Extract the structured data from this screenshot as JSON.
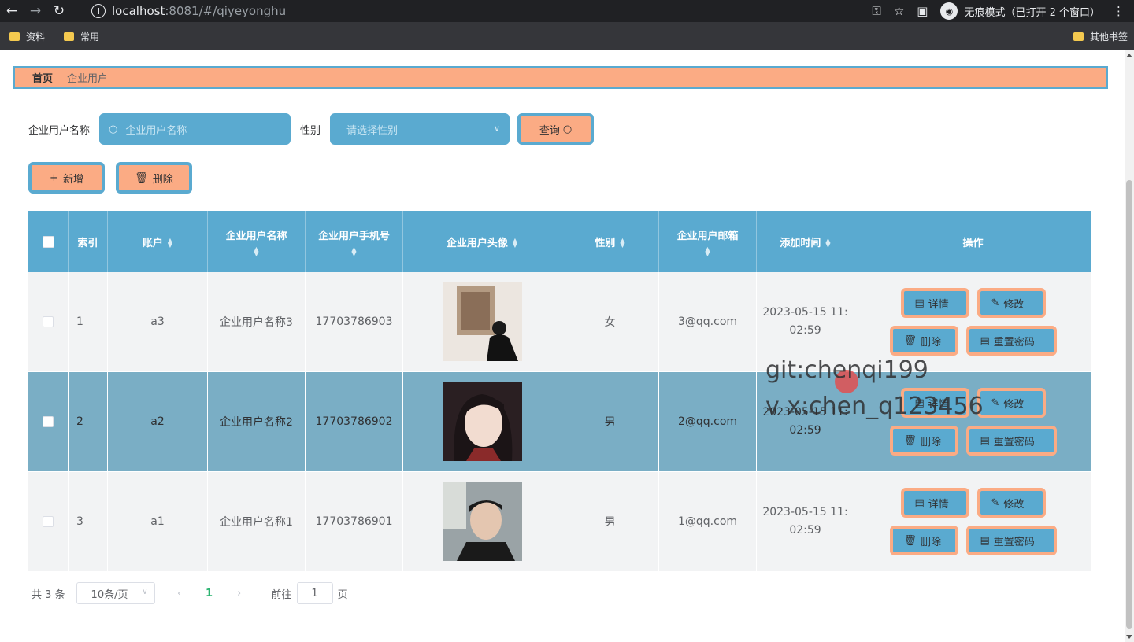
{
  "browser": {
    "url_host": "localhost",
    "url_rest": ":8081/#/qiyeyonghu",
    "incognito_label": "无痕模式（已打开 2 个窗口）",
    "bookmarks": [
      "资料",
      "常用"
    ],
    "other_bookmarks": "其他书签"
  },
  "breadcrumb": {
    "home": "首页",
    "current": "企业用户"
  },
  "search": {
    "name_label": "企业用户名称",
    "name_placeholder": "企业用户名称",
    "gender_label": "性别",
    "gender_placeholder": "请选择性别",
    "query_label": "查询"
  },
  "actions": {
    "add_label": "新增",
    "delete_label": "删除"
  },
  "table": {
    "headers": [
      "索引",
      "账户",
      "企业用户名称",
      "企业用户手机号",
      "企业用户头像",
      "性别",
      "企业用户邮箱",
      "添加时间",
      "操作"
    ],
    "rows": [
      {
        "index": "1",
        "account": "a3",
        "name": "企业用户名称3",
        "phone": "17703786903",
        "gender": "女",
        "email": "3@qq.com",
        "time1": "2023-05-15 11:",
        "time2": "02:59"
      },
      {
        "index": "2",
        "account": "a2",
        "name": "企业用户名称2",
        "phone": "17703786902",
        "gender": "男",
        "email": "2@qq.com",
        "time1": "2023-05-15 11:",
        "time2": "02:59"
      },
      {
        "index": "3",
        "account": "a1",
        "name": "企业用户名称1",
        "phone": "17703786901",
        "gender": "男",
        "email": "1@qq.com",
        "time1": "2023-05-15 11:",
        "time2": "02:59"
      }
    ],
    "op_labels": {
      "detail": "详情",
      "edit": "修改",
      "delete": "删除",
      "reset": "重置密码"
    }
  },
  "pager": {
    "total": "共 3 条",
    "page_size": "10条/页",
    "current_page": "1",
    "goto_label": "前往",
    "goto_value": "1",
    "page_unit": "页"
  },
  "watermark": {
    "line1": "git:chenqi199",
    "line2": "v x:chen_q123456"
  }
}
